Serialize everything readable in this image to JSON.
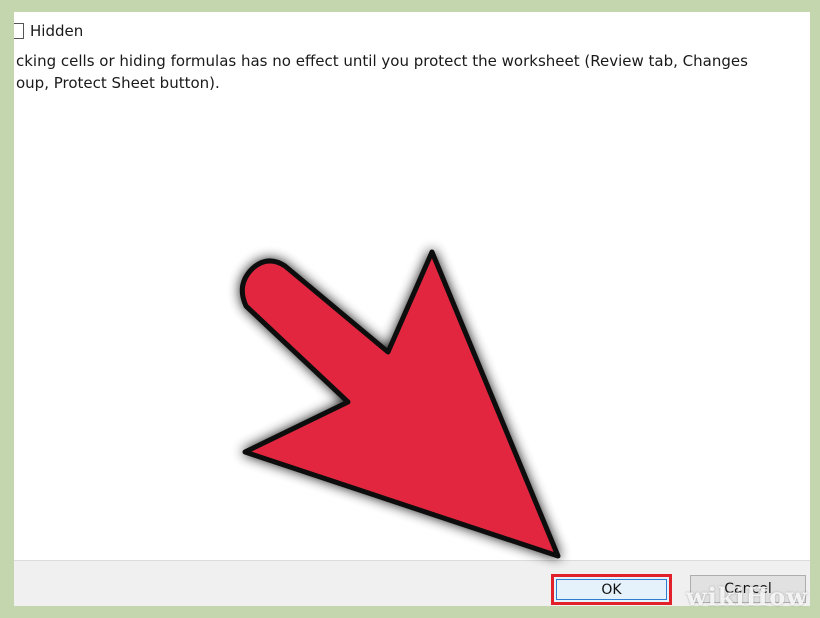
{
  "dialog": {
    "hidden_checkbox_label": "Hidden",
    "info_line_1": "cking cells or hiding formulas has no effect until you protect the worksheet (Review tab, Changes",
    "info_line_2": "oup, Protect Sheet button).",
    "ok_label": "OK",
    "cancel_label": "Cancel"
  },
  "overlay": {
    "arrow_icon": "red-pointer-arrow-icon",
    "arrow_color": "#e2283f",
    "highlight_color": "#e2202a"
  },
  "watermark": {
    "brand": "wikiHow"
  }
}
